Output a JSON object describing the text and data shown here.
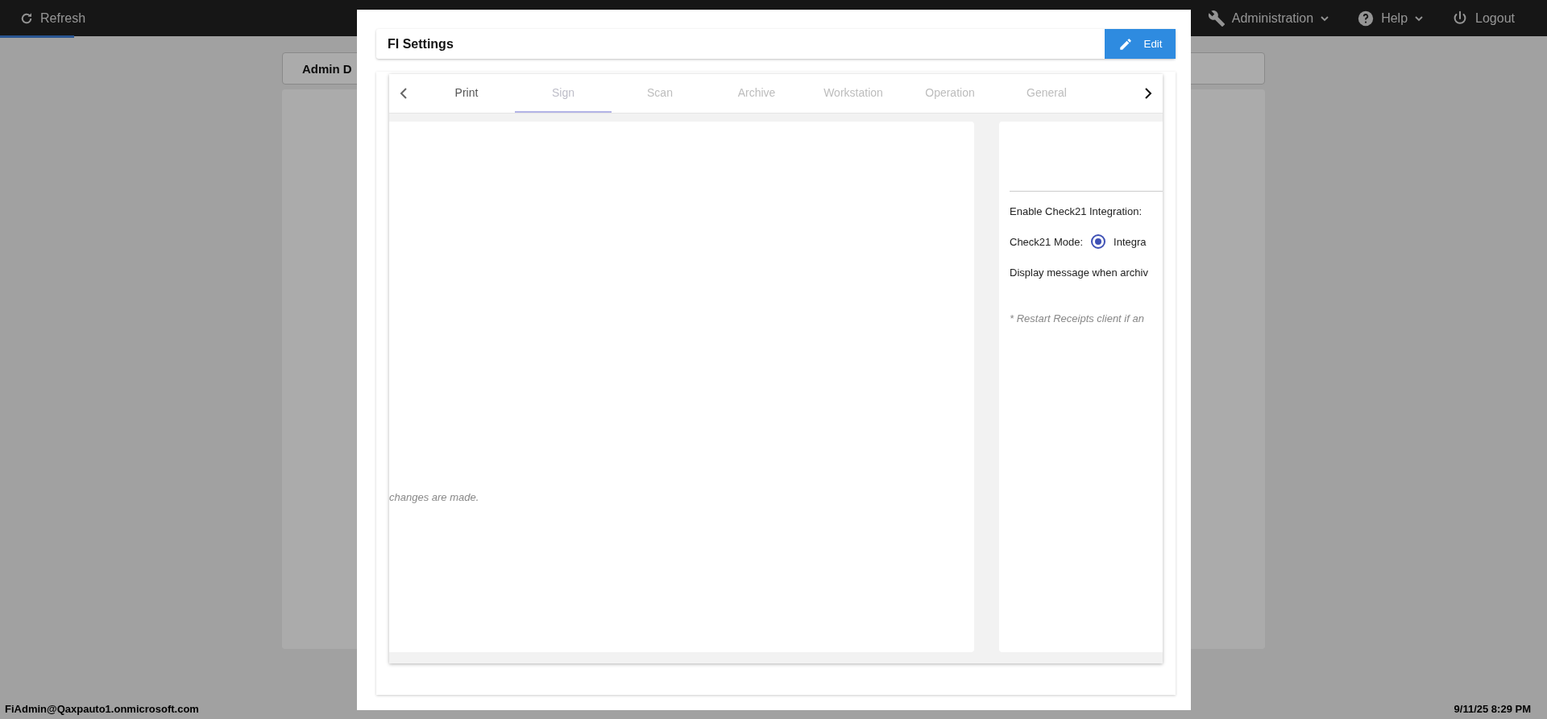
{
  "top_bar": {
    "refresh": "Refresh",
    "progress": {
      "level": 0.048
    },
    "menus": [
      {
        "label": "Administration",
        "kind": "wrench",
        "dropdown": true
      },
      {
        "label": "Help",
        "kind": "help",
        "dropdown": true
      },
      {
        "label": "Logout",
        "kind": "power",
        "dropdown": false
      }
    ]
  },
  "background": {
    "tab_label": "Admin D"
  },
  "dialog": {
    "title": "FI Settings",
    "edit_button": "Edit",
    "tabs": [
      {
        "label": "Print",
        "selected": false,
        "disabled": false
      },
      {
        "label": "Sign",
        "selected": true,
        "disabled": false
      },
      {
        "label": "Scan",
        "selected": false,
        "disabled": true
      },
      {
        "label": "Archive",
        "selected": false,
        "disabled": true
      },
      {
        "label": "Workstation",
        "selected": false,
        "disabled": true
      },
      {
        "label": "Operation",
        "selected": false,
        "disabled": true
      },
      {
        "label": "General",
        "selected": false,
        "disabled": true
      }
    ],
    "left_panel": {
      "note": "changes are made."
    },
    "right_panel": {
      "fields": [
        {
          "kind": "label",
          "label": "Enable Check21 Integration:"
        },
        {
          "kind": "radio",
          "label": "Check21 Mode:",
          "option": "Integra",
          "selected": true
        },
        {
          "kind": "label",
          "label": "Display message when archiv"
        }
      ],
      "note": "* Restart Receipts client if an"
    }
  },
  "status_bar": {
    "user": "FiAdmin@Qaxpauto1.onmicrosoft.com",
    "datetime": "9/11/25 8:29 PM"
  }
}
